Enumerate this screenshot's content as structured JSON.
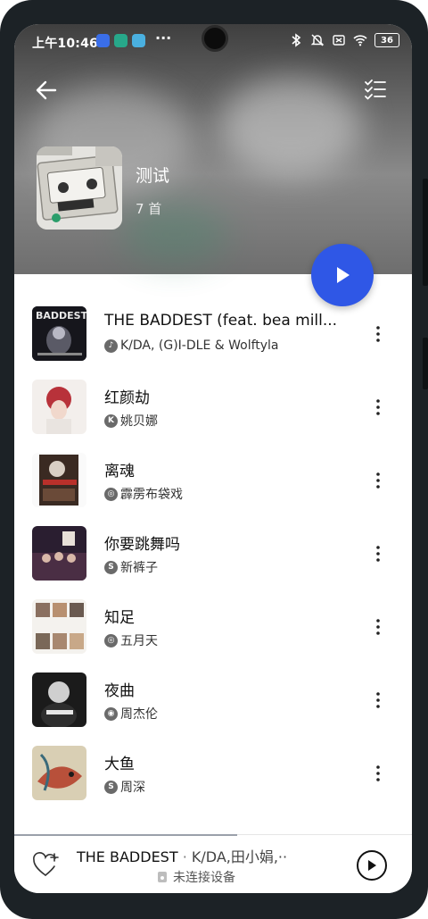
{
  "status_bar": {
    "time": "上午10:46",
    "battery": "36",
    "more": "···"
  },
  "header": {
    "playlist_title": "测试",
    "track_count": "7 首"
  },
  "songs": [
    {
      "title": "THE BADDEST (feat. bea mill...",
      "artist": "K/DA, (G)I-DLE & Wolftyla",
      "source_icon": "music-note"
    },
    {
      "title": "红颜劫",
      "artist": "姚贝娜",
      "source_icon": "k"
    },
    {
      "title": "离魂",
      "artist": "霹雳布袋戏",
      "source_icon": "netease"
    },
    {
      "title": "你要跳舞吗",
      "artist": "新裤子",
      "source_icon": "s"
    },
    {
      "title": "知足",
      "artist": "五月天",
      "source_icon": "netease"
    },
    {
      "title": "夜曲",
      "artist": "周杰伦",
      "source_icon": "qq"
    },
    {
      "title": "大鱼",
      "artist": "周深",
      "source_icon": "s"
    }
  ],
  "mini_player": {
    "title": "THE BADDEST",
    "separator": "·",
    "artist": "K/DA,田小娟,··",
    "device_status": "未连接设备",
    "progress": 0.56
  },
  "colors": {
    "accent": "#2f57e6"
  }
}
